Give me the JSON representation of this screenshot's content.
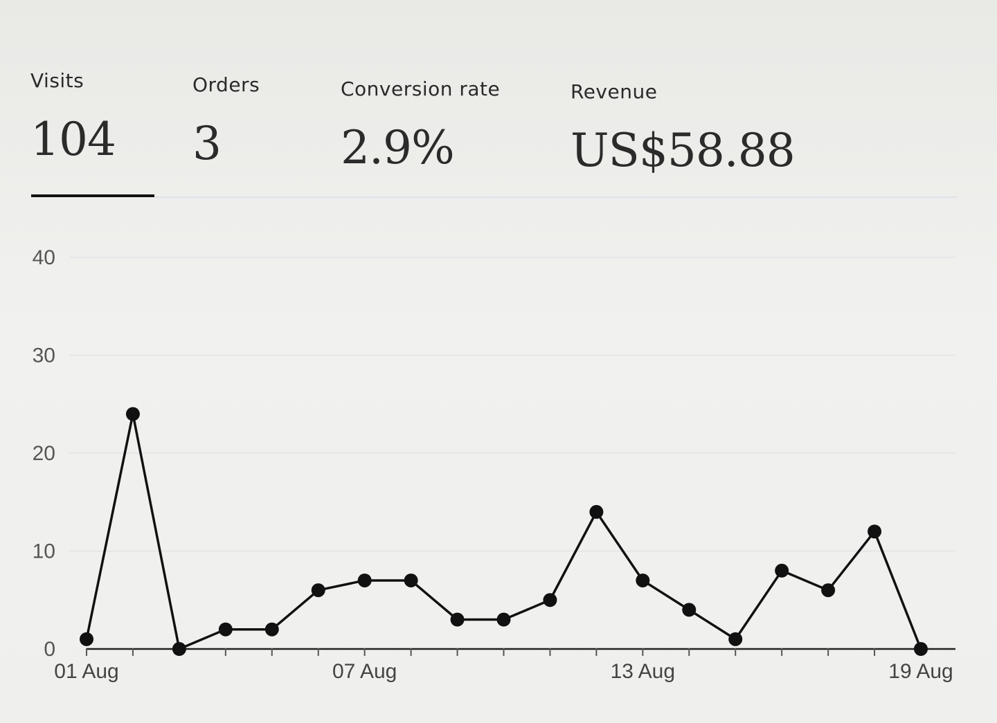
{
  "metrics": {
    "visits": {
      "label": "Visits",
      "value": "104"
    },
    "orders": {
      "label": "Orders",
      "value": "3"
    },
    "conversion": {
      "label": "Conversion rate",
      "value": "2.9%"
    },
    "revenue": {
      "label": "Revenue",
      "value": "US$58.88"
    }
  },
  "active_tab": "Visits",
  "colors": {
    "line": "#111111",
    "gridline": "#e2e4e6",
    "active_underline": "#111111",
    "tab_divider": "#dde2e8"
  },
  "chart_data": {
    "type": "line",
    "title": "",
    "xlabel": "",
    "ylabel": "",
    "ylim": [
      0,
      40
    ],
    "yticks": [
      0,
      10,
      20,
      30,
      40
    ],
    "x": [
      "01 Aug",
      "02 Aug",
      "03 Aug",
      "04 Aug",
      "05 Aug",
      "06 Aug",
      "07 Aug",
      "08 Aug",
      "09 Aug",
      "10 Aug",
      "11 Aug",
      "12 Aug",
      "13 Aug",
      "14 Aug",
      "15 Aug",
      "16 Aug",
      "17 Aug",
      "18 Aug",
      "19 Aug"
    ],
    "xtick_labels": [
      "01 Aug",
      "07 Aug",
      "13 Aug",
      "19 Aug"
    ],
    "xtick_label_indices": [
      0,
      6,
      12,
      18
    ],
    "series": [
      {
        "values": [
          1,
          24,
          0,
          2,
          2,
          6,
          7,
          7,
          3,
          3,
          5,
          14,
          7,
          4,
          1,
          8,
          6,
          12,
          0
        ]
      }
    ],
    "grid": true,
    "legend": "none"
  }
}
